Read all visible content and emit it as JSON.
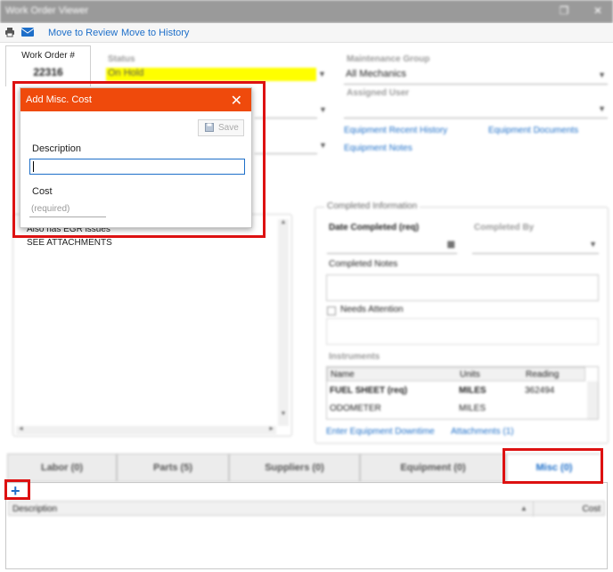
{
  "window": {
    "title": "Work Order Viewer",
    "restore_icon": "restore-icon",
    "close_icon": "close-icon",
    "restore_glyph": "❐",
    "close_glyph": "✕"
  },
  "toolbar": {
    "print_icon": "printer-icon",
    "email_icon": "envelope-icon",
    "move_review": "Move to Review",
    "move_history": "Move to History"
  },
  "work_order": {
    "label": "Work Order #",
    "number": "22316"
  },
  "status": {
    "label": "Status",
    "value": "On Hold"
  },
  "maintenance_group": {
    "label": "Maintenance Group",
    "value": "All Mechanics"
  },
  "assigned_user": {
    "label": "Assigned User",
    "value": ""
  },
  "links": {
    "recent_history": "Equipment Recent History",
    "documents": "Equipment Documents",
    "notes": "Equipment Notes",
    "downtime": "Enter Equipment Downtime",
    "attachments": "Attachments (1)"
  },
  "description_text": [
    "Also has EGR issues",
    "SEE ATTACHMENTS"
  ],
  "completed": {
    "group_label": "Completed Information",
    "date_label": "Date Completed (req)",
    "by_label": "Completed By",
    "notes_label": "Completed Notes",
    "needs_attention": "Needs Attention",
    "instruments_label": "Instruments",
    "columns": [
      "Name",
      "Units",
      "Reading"
    ],
    "rows": [
      {
        "name": "FUEL SHEET (req)",
        "units": "MILES",
        "reading": "362494"
      },
      {
        "name": "ODOMETER",
        "units": "MILES",
        "reading": ""
      }
    ]
  },
  "tabs": [
    "Labor (0)",
    "Parts (5)",
    "Suppliers (0)",
    "Equipment (0)",
    "Misc (0)"
  ],
  "misc_grid": {
    "add_icon": "plus-icon",
    "columns": [
      "Description",
      "Cost"
    ]
  },
  "dialog": {
    "title": "Add Misc. Cost",
    "close_glyph": "✕",
    "save_label": "Save",
    "save_icon": "floppy-disk-icon",
    "description_label": "Description",
    "description_value": "",
    "cost_label": "Cost",
    "cost_placeholder": "(required)"
  },
  "colors": {
    "accent": "#ef4a0c",
    "link": "#1e6fc9",
    "status_highlight": "#ffff00",
    "annotation": "#dd1111"
  }
}
